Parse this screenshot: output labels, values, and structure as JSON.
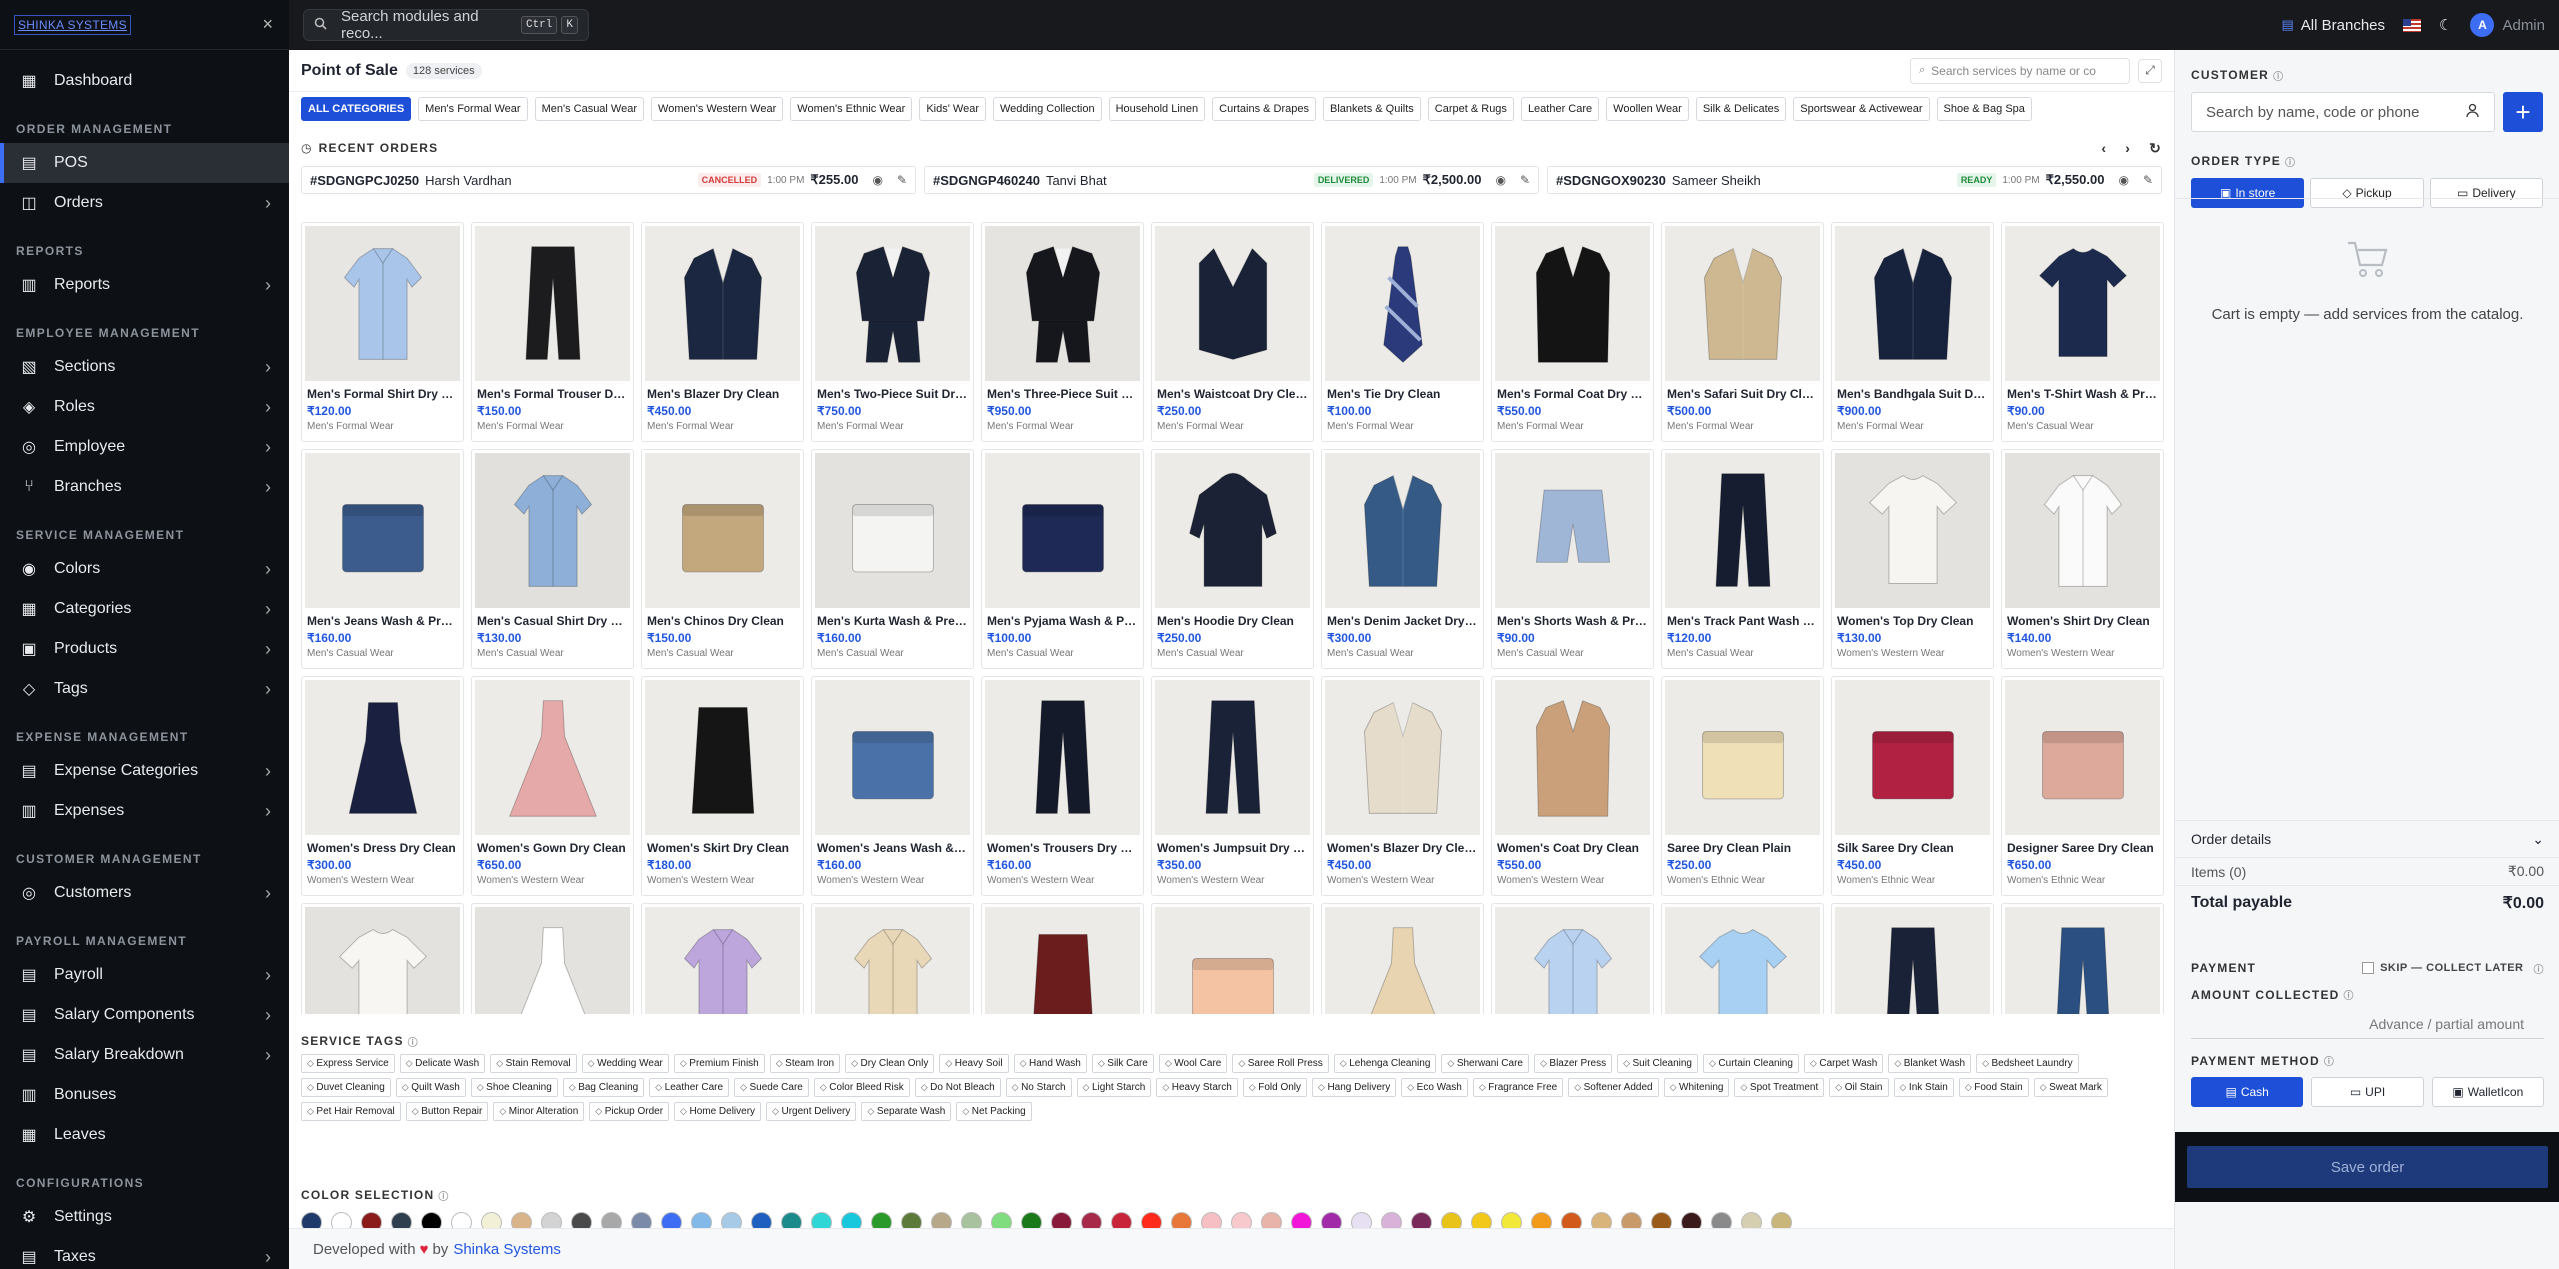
{
  "brand": "SHINKA SYSTEMS",
  "sidebar": {
    "close": "×",
    "sections": [
      {
        "title": "",
        "items": [
          {
            "label": "Dashboard",
            "icon": "dashboard-icon"
          }
        ]
      },
      {
        "title": "ORDER MANAGEMENT",
        "items": [
          {
            "label": "POS",
            "icon": "pos-icon",
            "active": true
          },
          {
            "label": "Orders",
            "icon": "orders-icon",
            "chev": true
          }
        ]
      },
      {
        "title": "REPORTS",
        "items": [
          {
            "label": "Reports",
            "icon": "reports-icon",
            "chev": true
          }
        ]
      },
      {
        "title": "EMPLOYEE MANAGEMENT",
        "items": [
          {
            "label": "Sections",
            "icon": "sections-icon",
            "chev": true
          },
          {
            "label": "Roles",
            "icon": "roles-icon",
            "chev": true
          },
          {
            "label": "Employee",
            "icon": "employee-icon",
            "chev": true
          },
          {
            "label": "Branches",
            "icon": "branches-icon",
            "chev": true
          }
        ]
      },
      {
        "title": "SERVICE MANAGEMENT",
        "items": [
          {
            "label": "Colors",
            "icon": "colors-icon",
            "chev": true
          },
          {
            "label": "Categories",
            "icon": "categories-icon",
            "chev": true
          },
          {
            "label": "Products",
            "icon": "products-icon",
            "chev": true
          },
          {
            "label": "Tags",
            "icon": "tags-icon",
            "chev": true
          }
        ]
      },
      {
        "title": "EXPENSE MANAGEMENT",
        "items": [
          {
            "label": "Expense Categories",
            "icon": "expense-categories-icon",
            "chev": true
          },
          {
            "label": "Expenses",
            "icon": "expenses-icon",
            "chev": true
          }
        ]
      },
      {
        "title": "CUSTOMER MANAGEMENT",
        "items": [
          {
            "label": "Customers",
            "icon": "customers-icon",
            "chev": true
          }
        ]
      },
      {
        "title": "PAYROLL MANAGEMENT",
        "items": [
          {
            "label": "Payroll",
            "icon": "payroll-icon",
            "chev": true
          },
          {
            "label": "Salary Components",
            "icon": "salary-components-icon",
            "chev": true
          },
          {
            "label": "Salary Breakdown",
            "icon": "salary-breakdown-icon",
            "chev": true
          },
          {
            "label": "Bonuses",
            "icon": "bonuses-icon"
          },
          {
            "label": "Leaves",
            "icon": "leaves-icon"
          }
        ]
      },
      {
        "title": "CONFIGURATIONS",
        "items": [
          {
            "label": "Settings",
            "icon": "settings-icon"
          },
          {
            "label": "Taxes",
            "icon": "taxes-icon",
            "chev": true
          }
        ]
      }
    ]
  },
  "topbar": {
    "search_placeholder": "Search modules and reco...",
    "kbd1": "Ctrl",
    "kbd2": "K",
    "branch": "All Branches",
    "user": "Admin",
    "avatar": "A"
  },
  "main": {
    "title": "Point of Sale",
    "count": "128 services",
    "search_placeholder": "Search services by name or co",
    "categories": [
      "ALL CATEGORIES",
      "Men's Formal Wear",
      "Men's Casual Wear",
      "Women's Western Wear",
      "Women's Ethnic Wear",
      "Kids' Wear",
      "Wedding Collection",
      "Household Linen",
      "Curtains & Drapes",
      "Blankets & Quilts",
      "Carpet & Rugs",
      "Leather Care",
      "Woollen Wear",
      "Silk & Delicates",
      "Sportswear & Activewear",
      "Shoe & Bag Spa"
    ],
    "recent_title": "RECENT ORDERS",
    "orders": [
      {
        "id": "#SDGNGPCJ0250",
        "name": "Harsh Vardhan",
        "status": "CANCELLED",
        "time": "1:00 PM",
        "amount": "₹255.00",
        "color": "#d23b3b",
        "bg": "#fdecec"
      },
      {
        "id": "#SDGNGP460240",
        "name": "Tanvi Bhat",
        "status": "DELIVERED",
        "time": "1:00 PM",
        "amount": "₹2,500.00",
        "color": "#1f8a3a",
        "bg": "#e6f5ea"
      },
      {
        "id": "#SDGNGOX90230",
        "name": "Sameer Sheikh",
        "status": "READY",
        "time": "1:00 PM",
        "amount": "₹2,550.00",
        "color": "#1f8a3a",
        "bg": "#e6f5ea"
      }
    ],
    "products": [
      {
        "name": "Men's Formal Shirt Dry Cle...",
        "price": "₹120.00",
        "cat": "Men's Formal Wear",
        "color": "#a9c5ea",
        "shape": "shirt",
        "bg": "#e8e6e2"
      },
      {
        "name": "Men's Formal Trouser Dry ...",
        "price": "₹150.00",
        "cat": "Men's Formal Wear",
        "color": "#1c1c1e",
        "shape": "trouser",
        "bg": "#ecebe8"
      },
      {
        "name": "Men's Blazer Dry Clean",
        "price": "₹450.00",
        "cat": "Men's Formal Wear",
        "color": "#1b2740",
        "shape": "blazer",
        "bg": "#ecebe8"
      },
      {
        "name": "Men's Two-Piece Suit Dry ...",
        "price": "₹750.00",
        "cat": "Men's Formal Wear",
        "color": "#1a2236",
        "shape": "suit",
        "bg": "#ecebe8"
      },
      {
        "name": "Men's Three-Piece Suit Dr...",
        "price": "₹950.00",
        "cat": "Men's Formal Wear",
        "color": "#15171d",
        "shape": "suit",
        "bg": "#e6e4e0"
      },
      {
        "name": "Men's Waistcoat Dry Clean",
        "price": "₹250.00",
        "cat": "Men's Formal Wear",
        "color": "#1a2238",
        "shape": "vest",
        "bg": "#ecebe8"
      },
      {
        "name": "Men's Tie Dry Clean",
        "price": "₹100.00",
        "cat": "Men's Formal Wear",
        "color": "#2a3a7a",
        "shape": "tie",
        "bg": "#ecebe8"
      },
      {
        "name": "Men's Formal Coat Dry Cle...",
        "price": "₹550.00",
        "cat": "Men's Formal Wear",
        "color": "#141414",
        "shape": "coat",
        "bg": "#ecebe8"
      },
      {
        "name": "Men's Safari Suit Dry Clean",
        "price": "₹500.00",
        "cat": "Men's Formal Wear",
        "color": "#cdb891",
        "shape": "blazer",
        "bg": "#ecebe8"
      },
      {
        "name": "Men's Bandhgala Suit Dry ...",
        "price": "₹900.00",
        "cat": "Men's Formal Wear",
        "color": "#17223c",
        "shape": "blazer",
        "bg": "#ecebe8"
      },
      {
        "name": "Men's T-Shirt Wash & Press",
        "price": "₹90.00",
        "cat": "Men's Casual Wear",
        "color": "#1c2a4e",
        "shape": "tshirt",
        "bg": "#ecebe8"
      },
      {
        "name": "Men's Jeans Wash & Press",
        "price": "₹160.00",
        "cat": "Men's Casual Wear",
        "color": "#3b5c8c",
        "shape": "folded",
        "bg": "#ecebe8"
      },
      {
        "name": "Men's Casual Shirt Dry Cle...",
        "price": "₹130.00",
        "cat": "Men's Casual Wear",
        "color": "#8eb0d8",
        "shape": "shirt",
        "bg": "#e2e0dc"
      },
      {
        "name": "Men's Chinos Dry Clean",
        "price": "₹150.00",
        "cat": "Men's Casual Wear",
        "color": "#c3a87e",
        "shape": "folded",
        "bg": "#ecebe8"
      },
      {
        "name": "Men's Kurta Wash & Press",
        "price": "₹160.00",
        "cat": "Men's Casual Wear",
        "color": "#f4f4f2",
        "shape": "folded",
        "bg": "#e4e2de"
      },
      {
        "name": "Men's Pyjama Wash & Press",
        "price": "₹100.00",
        "cat": "Men's Casual Wear",
        "color": "#1e2a55",
        "shape": "folded",
        "bg": "#ecebe8"
      },
      {
        "name": "Men's Hoodie Dry Clean",
        "price": "₹250.00",
        "cat": "Men's Casual Wear",
        "color": "#1b2235",
        "shape": "hoodie",
        "bg": "#ecebe8"
      },
      {
        "name": "Men's Denim Jacket Dry Cl...",
        "price": "₹300.00",
        "cat": "Men's Casual Wear",
        "color": "#355a86",
        "shape": "blazer",
        "bg": "#ecebe8"
      },
      {
        "name": "Men's Shorts Wash & Press",
        "price": "₹90.00",
        "cat": "Men's Casual Wear",
        "color": "#9fb6d6",
        "shape": "shorts",
        "bg": "#ecebe8"
      },
      {
        "name": "Men's Track Pant Wash & ...",
        "price": "₹120.00",
        "cat": "Men's Casual Wear",
        "color": "#161d30",
        "shape": "trouser",
        "bg": "#ecebe8"
      },
      {
        "name": "Women's Top Dry Clean",
        "price": "₹130.00",
        "cat": "Women's Western Wear",
        "color": "#f6f5f1",
        "shape": "tshirt",
        "bg": "#e4e2de"
      },
      {
        "name": "Women's Shirt Dry Clean",
        "price": "₹140.00",
        "cat": "Women's Western Wear",
        "color": "#fafafa",
        "shape": "shirt",
        "bg": "#e4e2de"
      },
      {
        "name": "Women's Dress Dry Clean",
        "price": "₹300.00",
        "cat": "Women's Western Wear",
        "color": "#1a2140",
        "shape": "dress",
        "bg": "#ecebe8"
      },
      {
        "name": "Women's Gown Dry Clean",
        "price": "₹650.00",
        "cat": "Women's Western Wear",
        "color": "#e4a9a8",
        "shape": "gown",
        "bg": "#ecebe8"
      },
      {
        "name": "Women's Skirt Dry Clean",
        "price": "₹180.00",
        "cat": "Women's Western Wear",
        "color": "#151515",
        "shape": "skirt",
        "bg": "#ecebe8"
      },
      {
        "name": "Women's Jeans Wash & Pr...",
        "price": "₹160.00",
        "cat": "Women's Western Wear",
        "color": "#4a72a8",
        "shape": "folded",
        "bg": "#ecebe8"
      },
      {
        "name": "Women's Trousers Dry Clean",
        "price": "₹160.00",
        "cat": "Women's Western Wear",
        "color": "#151a2a",
        "shape": "trouser",
        "bg": "#ecebe8"
      },
      {
        "name": "Women's Jumpsuit Dry Cl...",
        "price": "₹350.00",
        "cat": "Women's Western Wear",
        "color": "#1a2238",
        "shape": "trouser",
        "bg": "#ecebe8"
      },
      {
        "name": "Women's Blazer Dry Clean",
        "price": "₹450.00",
        "cat": "Women's Western Wear",
        "color": "#e6dccb",
        "shape": "blazer",
        "bg": "#ecebe8"
      },
      {
        "name": "Women's Coat Dry Clean",
        "price": "₹550.00",
        "cat": "Women's Western Wear",
        "color": "#c9a07a",
        "shape": "coat",
        "bg": "#ecebe8"
      },
      {
        "name": "Saree Dry Clean Plain",
        "price": "₹250.00",
        "cat": "Women's Ethnic Wear",
        "color": "#efe0b8",
        "shape": "folded",
        "bg": "#ecebe8"
      },
      {
        "name": "Silk Saree Dry Clean",
        "price": "₹450.00",
        "cat": "Women's Ethnic Wear",
        "color": "#b02142",
        "shape": "folded",
        "bg": "#ecebe8"
      },
      {
        "name": "Designer Saree Dry Clean",
        "price": "₹650.00",
        "cat": "Women's Ethnic Wear",
        "color": "#dca99a",
        "shape": "folded",
        "bg": "#ecebe8"
      },
      {
        "name": "",
        "price": "",
        "cat": "",
        "color": "#f7f6f3",
        "shape": "tshirt",
        "bg": "#e4e2de"
      },
      {
        "name": "",
        "price": "",
        "cat": "",
        "color": "#ffffff",
        "shape": "gown",
        "bg": "#e4e2de"
      },
      {
        "name": "",
        "price": "",
        "cat": "",
        "color": "#bca6dc",
        "shape": "shirt",
        "bg": "#ecebe8"
      },
      {
        "name": "",
        "price": "",
        "cat": "",
        "color": "#e9d8b8",
        "shape": "shirt",
        "bg": "#ecebe8"
      },
      {
        "name": "",
        "price": "",
        "cat": "",
        "color": "#6b1c1c",
        "shape": "skirt",
        "bg": "#ecebe8"
      },
      {
        "name": "",
        "price": "",
        "cat": "",
        "color": "#f3c3a3",
        "shape": "folded",
        "bg": "#ecebe8"
      },
      {
        "name": "",
        "price": "",
        "cat": "",
        "color": "#e8d4b0",
        "shape": "gown",
        "bg": "#ecebe8"
      },
      {
        "name": "",
        "price": "",
        "cat": "",
        "color": "#b9d2f0",
        "shape": "shirt",
        "bg": "#ecebe8"
      },
      {
        "name": "",
        "price": "",
        "cat": "",
        "color": "#a8d0f2",
        "shape": "tshirt",
        "bg": "#ecebe8"
      },
      {
        "name": "",
        "price": "",
        "cat": "",
        "color": "#1a2238",
        "shape": "trouser",
        "bg": "#ecebe8"
      },
      {
        "name": "",
        "price": "",
        "cat": "",
        "color": "#2a4f80",
        "shape": "trouser",
        "bg": "#ecebe8"
      }
    ],
    "tags_title": "SERVICE TAGS",
    "tags": [
      "Express Service",
      "Delicate Wash",
      "Stain Removal",
      "Wedding Wear",
      "Premium Finish",
      "Steam Iron",
      "Dry Clean Only",
      "Heavy Soil",
      "Hand Wash",
      "Silk Care",
      "Wool Care",
      "Saree Roll Press",
      "Lehenga Cleaning",
      "Sherwani Care",
      "Blazer Press",
      "Suit Cleaning",
      "Curtain Cleaning",
      "Carpet Wash",
      "Blanket Wash",
      "Bedsheet Laundry",
      "Duvet Cleaning",
      "Quilt Wash",
      "Shoe Cleaning",
      "Bag Cleaning",
      "Leather Care",
      "Suede Care",
      "Color Bleed Risk",
      "Do Not Bleach",
      "No Starch",
      "Light Starch",
      "Heavy Starch",
      "Fold Only",
      "Hang Delivery",
      "Eco Wash",
      "Fragrance Free",
      "Softener Added",
      "Whitening",
      "Spot Treatment",
      "Oil Stain",
      "Ink Stain",
      "Food Stain",
      "Sweat Mark",
      "Pet Hair Removal",
      "Button Repair",
      "Minor Alteration",
      "Pickup Order",
      "Home Delivery",
      "Urgent Delivery",
      "Separate Wash",
      "Net Packing"
    ],
    "colors_title": "COLOR SELECTION",
    "colors": [
      "#1f3a6a",
      "#ffffff",
      "#8b1a1a",
      "#2f3f4f",
      "#000000",
      "#ffffff",
      "#f3f0d8",
      "#d9b48a",
      "#d3d3d3",
      "#4a4a4a",
      "#a8a8a8",
      "#7a8aa8",
      "#3d6df2",
      "#82b9e8",
      "#a7cbe6",
      "#1f5fbf",
      "#1a8a8a",
      "#2fd6d6",
      "#17c7dc",
      "#2a9a2a",
      "#5c7a3a",
      "#b7a88a",
      "#a8c2a0",
      "#7fdc7f",
      "#1a7a1a",
      "#8a1a3a",
      "#a82a4a",
      "#c8243a",
      "#ff2a1a",
      "#e8773a",
      "#f6bfc4",
      "#f8c9cc",
      "#e8b3a8",
      "#f217d8",
      "#a02aa8",
      "#e6e0f2",
      "#d8b2d8",
      "#7a2a5a",
      "#e8c41a",
      "#f2c81a",
      "#f2e83a",
      "#f29a1a",
      "#d25a1a",
      "#d9b47a",
      "#c89a6a",
      "#9a5a1a",
      "#3a1a1a",
      "#8a8a8a",
      "#d6ceb0",
      "#c8b67a"
    ],
    "footer_pre": "Developed with",
    "footer_heart": "♥",
    "footer_by": "by",
    "footer_link": "Shinka Systems"
  },
  "panel": {
    "customer_title": "CUSTOMER",
    "customer_placeholder": "Search by name, code or phone",
    "add": "+",
    "order_type_title": "ORDER TYPE",
    "order_types": [
      "In store",
      "Pickup",
      "Delivery"
    ],
    "cart_empty": "Cart is empty — add services from the catalog.",
    "order_details": "Order details",
    "items_label": "Items (0)",
    "items_value": "₹0.00",
    "total_label": "Total payable",
    "total_value": "₹0.00",
    "payment_title": "PAYMENT",
    "skip": "SKIP — COLLECT LATER",
    "amount_title": "AMOUNT COLLECTED",
    "amount_placeholder": "Advance / partial amount",
    "method_title": "PAYMENT METHOD",
    "methods": [
      "Cash",
      "UPI",
      "WalletIcon"
    ],
    "save": "Save order"
  }
}
